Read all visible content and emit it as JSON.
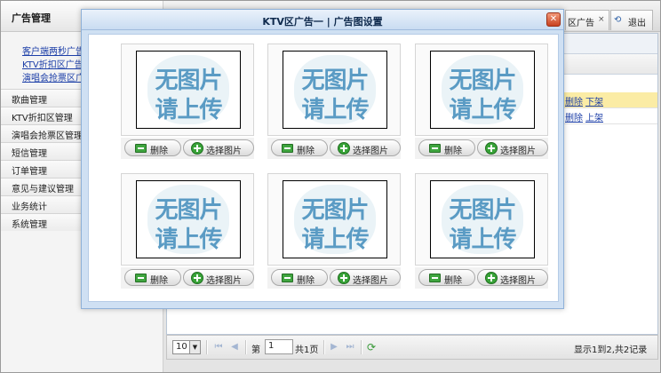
{
  "sidebar": {
    "header": "广告管理",
    "subitems": [
      "客户端两秒广告",
      "KTV折扣区广告",
      "演唱会抢票区广告"
    ],
    "items": [
      "歌曲管理",
      "KTV折扣区管理",
      "演唱会抢票区管理",
      "短信管理",
      "订单管理",
      "意见与建议管理",
      "业务统计",
      "系统管理"
    ]
  },
  "tabs": {
    "active_label": "区广告",
    "exit_label": "退出"
  },
  "grid": {
    "rows": [
      {
        "action1": "删除",
        "action2": "下架"
      },
      {
        "action1": "删除",
        "action2": "上架"
      }
    ]
  },
  "pager": {
    "page_size": "10",
    "page_prefix": "第",
    "page_value": "1",
    "page_suffix": "共1页",
    "summary": "显示1到2,共2记录"
  },
  "modal": {
    "title": "KTV区广告一 | 广告图设置",
    "close_glyph": "✕",
    "placeholder_line1": "无图片",
    "placeholder_line2": "请上传",
    "delete_label": "删除",
    "select_label": "选择图片",
    "slots": 6
  }
}
